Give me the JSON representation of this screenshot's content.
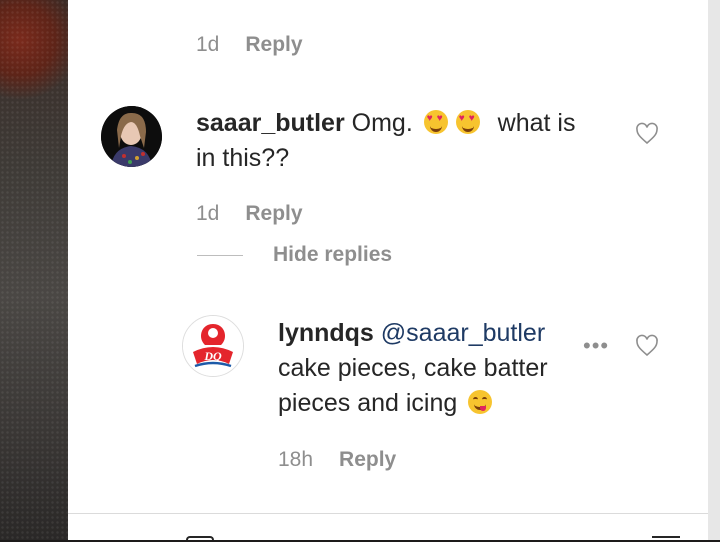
{
  "previous_comment": {
    "time": "1d",
    "reply_label": "Reply"
  },
  "comment": {
    "username": "saaar_butler",
    "text_before": "Omg.",
    "emoji": "heart-eyes",
    "text_middle": "what is",
    "text_after": "in this??",
    "time": "1d",
    "reply_label": "Reply"
  },
  "hide_replies_label": "Hide replies",
  "reply": {
    "username": "lynndqs",
    "mention": "@saaar_butler",
    "text_line1": "cake pieces, cake batter",
    "text_line2": "pieces and icing",
    "emoji": "yum-face",
    "time": "18h",
    "reply_label": "Reply",
    "more_label": "•••",
    "avatar_logo_text": "DQ"
  },
  "colors": {
    "text": "#262626",
    "muted": "#8e8e8e",
    "mention": "#1e3a64",
    "brand_red": "#e4252c"
  }
}
